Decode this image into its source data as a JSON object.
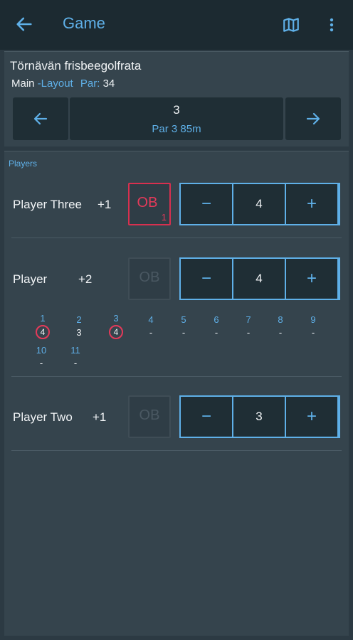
{
  "appbar": {
    "title": "Game",
    "back_icon": "arrow-left-icon",
    "map_icon": "map-icon",
    "more_icon": "more-vertical-icon"
  },
  "course": {
    "name": "Törnävän frisbeegolfrata",
    "layout_name": "Main",
    "layout_suffix": "-Layout",
    "par_label": "Par:",
    "par_value": "34"
  },
  "hole": {
    "number": "3",
    "info": "Par 3  85m"
  },
  "players_header": "Players",
  "ob_label": "OB",
  "stepper": {
    "minus": "−",
    "plus": "+"
  },
  "players": [
    {
      "name": "Player Three",
      "diff": "+1",
      "ob_active": true,
      "ob_count": "1",
      "score": "4"
    },
    {
      "name": "Player",
      "diff": "+2",
      "ob_active": false,
      "score": "4"
    },
    {
      "name": "Player Two",
      "diff": "+1",
      "ob_active": false,
      "score": "3"
    }
  ],
  "history": [
    {
      "hole": "1",
      "score": "4",
      "circled": true
    },
    {
      "hole": "2",
      "score": "3",
      "circled": false
    },
    {
      "hole": "3",
      "score": "4",
      "circled": true
    },
    {
      "hole": "4",
      "score": "-",
      "circled": false
    },
    {
      "hole": "5",
      "score": "-",
      "circled": false
    },
    {
      "hole": "6",
      "score": "-",
      "circled": false
    },
    {
      "hole": "7",
      "score": "-",
      "circled": false
    },
    {
      "hole": "8",
      "score": "-",
      "circled": false
    },
    {
      "hole": "9",
      "score": "-",
      "circled": false
    },
    {
      "hole": "10",
      "score": "-",
      "circled": false
    },
    {
      "hole": "11",
      "score": "-",
      "circled": false
    }
  ]
}
